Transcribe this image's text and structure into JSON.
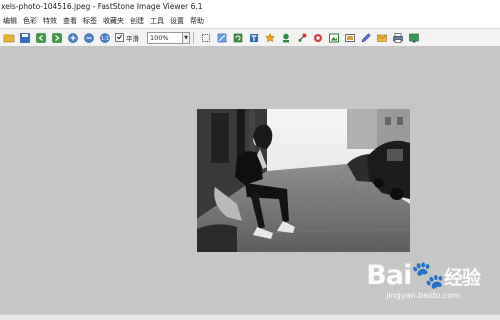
{
  "window": {
    "title": "xels-photo-104516.jpeg  -  FastStone Image Viewer 6.1"
  },
  "menu": [
    "编辑",
    "色彩",
    "特效",
    "查看",
    "标签",
    "收藏夹",
    "创建",
    "工具",
    "设置",
    "帮助"
  ],
  "toolbar": {
    "smooth_label": "平滑",
    "zoom_value": "100%",
    "icons": [
      "open-icon",
      "save-icon",
      "prev-icon",
      "next-icon",
      "zoom-in-icon",
      "zoom-out-icon",
      "actual-size-icon",
      "crop-icon",
      "resize-icon",
      "rotate-icon",
      "text-icon",
      "adjust-icon",
      "color-icon",
      "red-eye-icon",
      "effects-icon",
      "frame-icon",
      "slideshow-icon",
      "draw-icon",
      "email-icon",
      "print-icon",
      "wallpaper-icon"
    ]
  },
  "watermark": {
    "brand_a": "Bai",
    "brand_b": "经验",
    "url": "jingyan.baidu.com"
  }
}
